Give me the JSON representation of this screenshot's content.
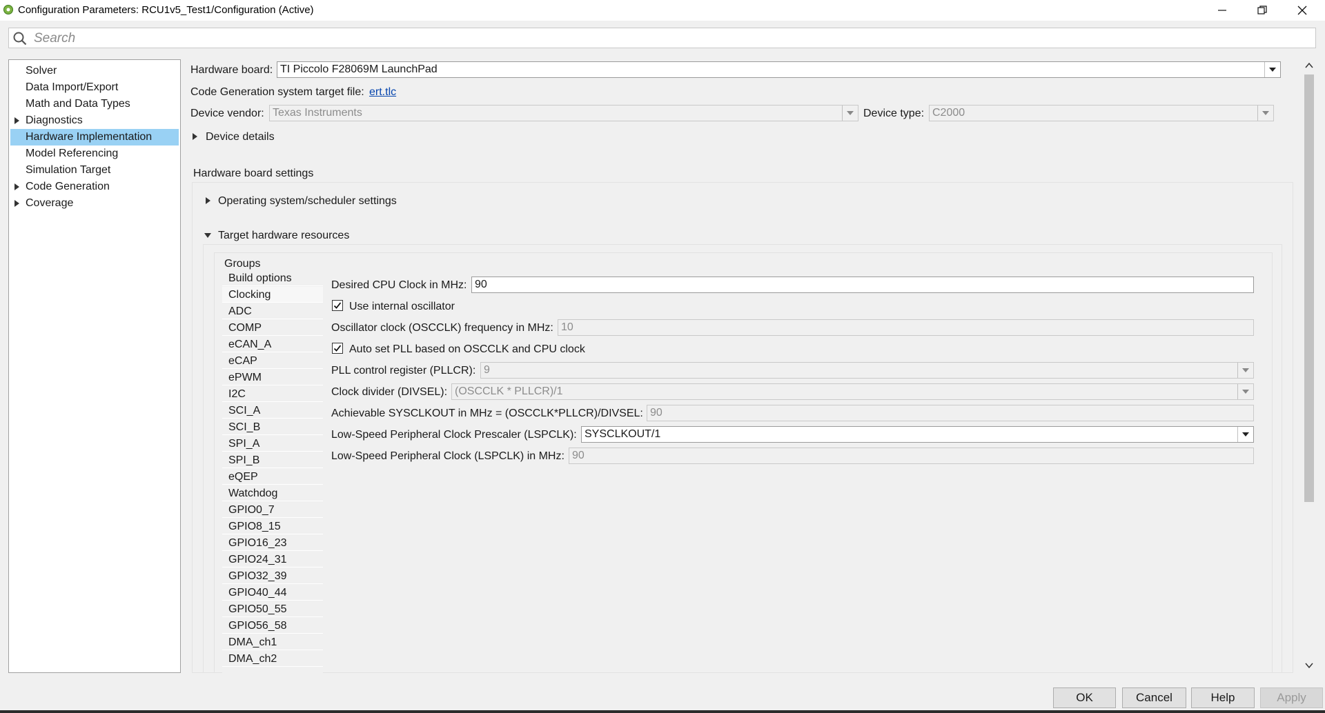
{
  "window": {
    "title": "Configuration Parameters: RCU1v5_Test1/Configuration (Active)"
  },
  "search": {
    "placeholder": "Search"
  },
  "tree": {
    "items": [
      {
        "label": "Solver",
        "expandable": false
      },
      {
        "label": "Data Import/Export",
        "expandable": false
      },
      {
        "label": "Math and Data Types",
        "expandable": false
      },
      {
        "label": "Diagnostics",
        "expandable": true
      },
      {
        "label": "Hardware Implementation",
        "expandable": false,
        "selected": true
      },
      {
        "label": "Model Referencing",
        "expandable": false
      },
      {
        "label": "Simulation Target",
        "expandable": false
      },
      {
        "label": "Code Generation",
        "expandable": true
      },
      {
        "label": "Coverage",
        "expandable": true
      }
    ]
  },
  "hardware": {
    "board_label": "Hardware board:",
    "board_value": "TI Piccolo F28069M LaunchPad",
    "codegen_label": "Code Generation system target file:",
    "codegen_link": "ert.tlc",
    "vendor_label": "Device vendor:",
    "vendor_value": "Texas Instruments",
    "type_label": "Device type:",
    "type_value": "C2000",
    "device_details": "Device details",
    "board_settings": "Hardware board settings",
    "os_settings": "Operating system/scheduler settings",
    "target_resources": "Target hardware resources",
    "groups_label": "Groups"
  },
  "groups": [
    "Build options",
    "Clocking",
    "ADC",
    "COMP",
    "eCAN_A",
    "eCAP",
    "ePWM",
    "I2C",
    "SCI_A",
    "SCI_B",
    "SPI_A",
    "SPI_B",
    "eQEP",
    "Watchdog",
    "GPIO0_7",
    "GPIO8_15",
    "GPIO16_23",
    "GPIO24_31",
    "GPIO32_39",
    "GPIO40_44",
    "GPIO50_55",
    "GPIO56_58",
    "DMA_ch1",
    "DMA_ch2"
  ],
  "selected_group": "Clocking",
  "clocking": {
    "cpu_clock_label": "Desired CPU Clock in MHz:",
    "cpu_clock_value": "90",
    "internal_osc_label": "Use internal oscillator",
    "internal_osc_checked": true,
    "osc_freq_label": "Oscillator clock (OSCCLK) frequency in MHz:",
    "osc_freq_value": "10",
    "auto_pll_label": "Auto set PLL based on OSCCLK and CPU clock",
    "auto_pll_checked": true,
    "pllcr_label": "PLL control register (PLLCR):",
    "pllcr_value": "9",
    "divsel_label": "Clock divider (DIVSEL):",
    "divsel_value": "(OSCCLK * PLLCR)/1",
    "sysclk_label": "Achievable SYSCLKOUT in MHz = (OSCCLK*PLLCR)/DIVSEL:",
    "sysclk_value": "90",
    "lspclk_prescaler_label": "Low-Speed Peripheral Clock Prescaler (LSPCLK):",
    "lspclk_prescaler_value": "SYSCLKOUT/1",
    "lspclk_label": "Low-Speed Peripheral Clock (LSPCLK) in MHz:",
    "lspclk_value": "90"
  },
  "buttons": {
    "ok": "OK",
    "cancel": "Cancel",
    "help": "Help",
    "apply": "Apply"
  }
}
